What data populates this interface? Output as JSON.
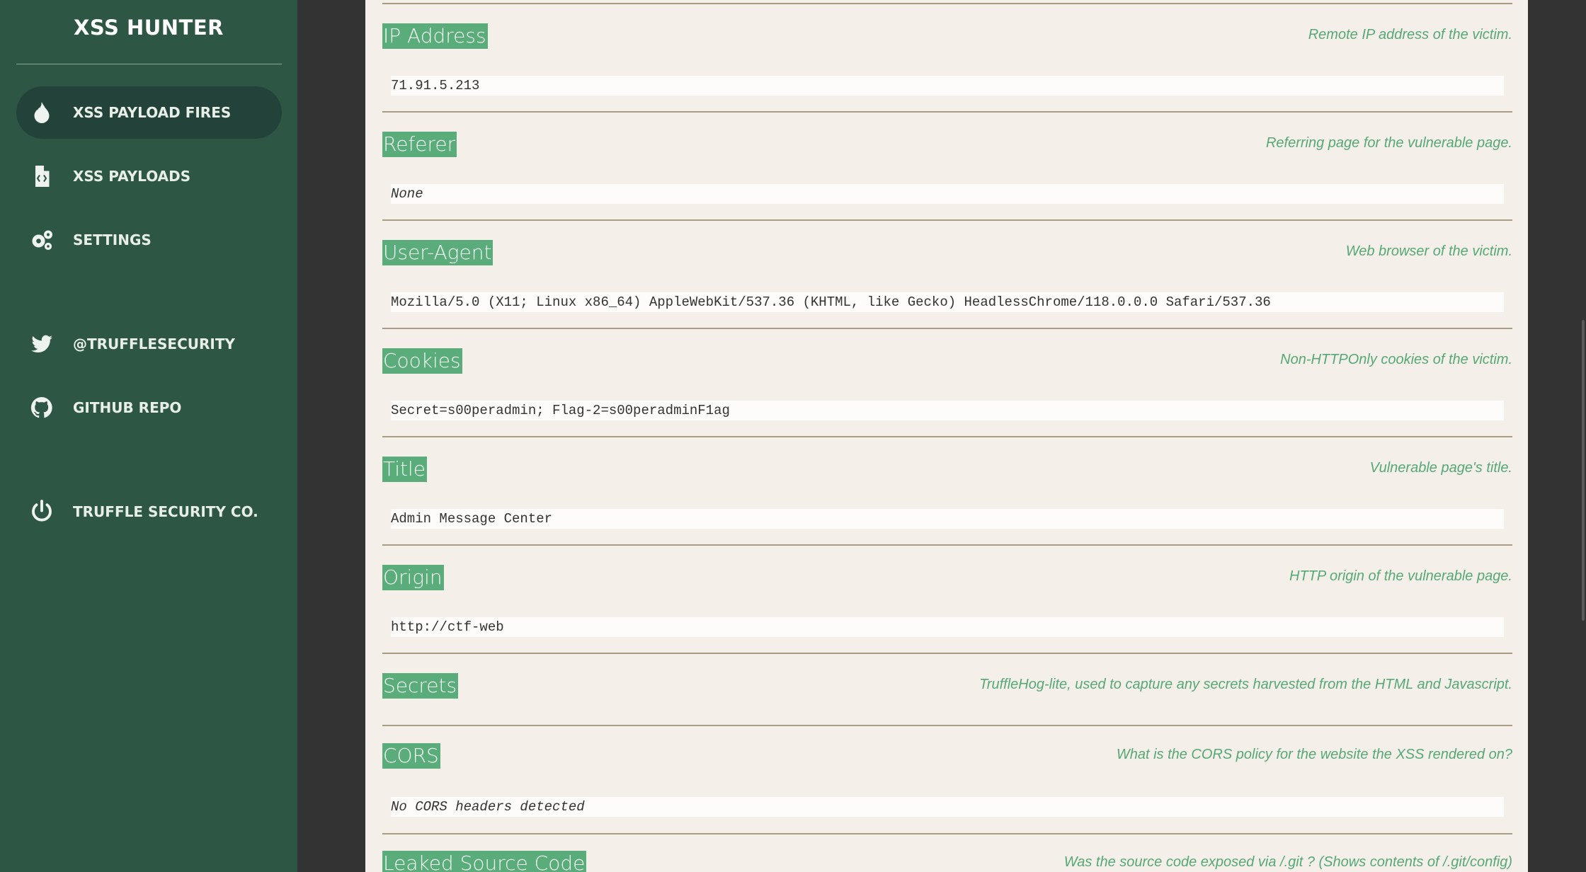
{
  "sidebar": {
    "brand": "XSS HUNTER",
    "items": [
      {
        "label": "XSS PAYLOAD FIRES",
        "icon": "fire-icon",
        "active": true
      },
      {
        "label": "XSS PAYLOADS",
        "icon": "code-file-icon",
        "active": false
      },
      {
        "label": "SETTINGS",
        "icon": "gears-icon",
        "active": false
      },
      {
        "label": "@TRUFFLESECURITY",
        "icon": "twitter-icon",
        "active": false
      },
      {
        "label": "GITHUB REPO",
        "icon": "github-icon",
        "active": false
      },
      {
        "label": "TRUFFLE SECURITY CO.",
        "icon": "power-icon",
        "active": false
      }
    ]
  },
  "fields": [
    {
      "label": "IP Address",
      "description": "Remote IP address of the victim.",
      "value": "71.91.5.213"
    },
    {
      "label": "Referer",
      "description": "Referring page for the vulnerable page.",
      "value": "None"
    },
    {
      "label": "User-Agent",
      "description": "Web browser of the victim.",
      "value": "Mozilla/5.0 (X11; Linux x86_64) AppleWebKit/537.36 (KHTML, like Gecko) HeadlessChrome/118.0.0.0 Safari/537.36"
    },
    {
      "label": "Cookies",
      "description": "Non-HTTPOnly cookies of the victim.",
      "value": "Secret=s00peradmin; Flag-2=s00peradminF1ag"
    },
    {
      "label": "Title",
      "description": "Vulnerable page's title.",
      "value": "Admin Message Center"
    },
    {
      "label": "Origin",
      "description": "HTTP origin of the vulnerable page.",
      "value": "http://ctf-web"
    },
    {
      "label": "Secrets",
      "description": "TruffleHog-lite, used to capture any secrets harvested from the HTML and Javascript.",
      "value": ""
    },
    {
      "label": "CORS",
      "description": "What is the CORS policy for the website the XSS rendered on?",
      "value": "No CORS headers detected"
    },
    {
      "label": "Leaked Source Code",
      "description": "Was the source code exposed via /.git ? (Shows contents of /.git/config)",
      "value": ""
    }
  ],
  "colors": {
    "sidebar_bg": "#2e5645",
    "active_item_bg": "#23433a",
    "label_bg": "#5aac7a",
    "desc_text": "#56a877",
    "content_bg": "#f4efe8"
  }
}
